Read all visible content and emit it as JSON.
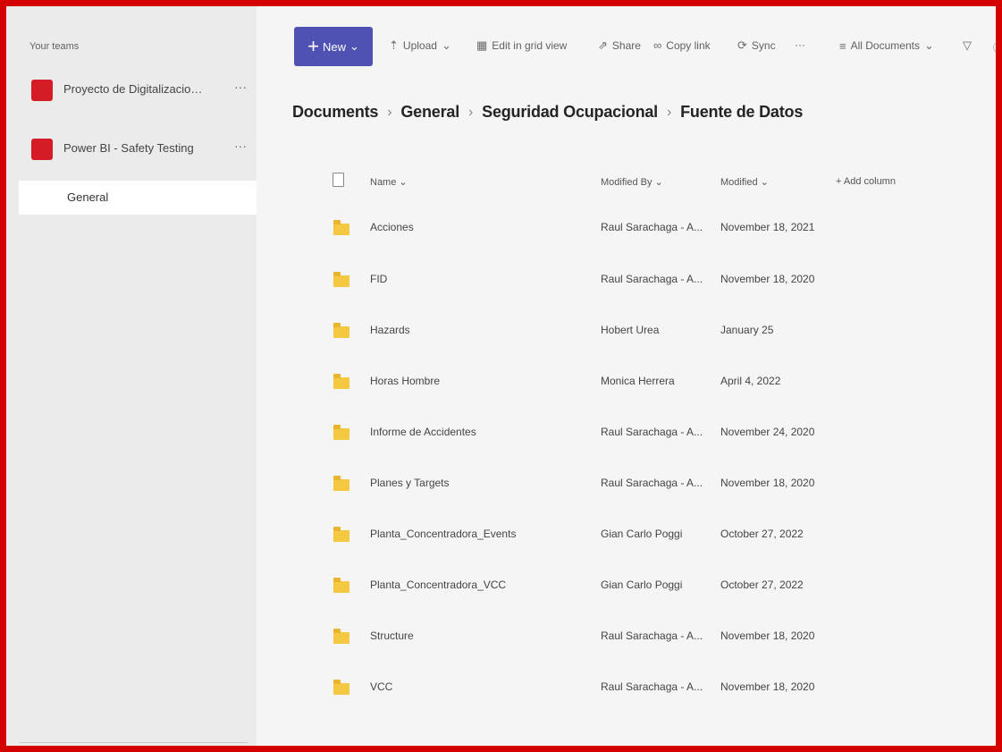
{
  "sidebar": {
    "title": "Your teams",
    "teams": [
      {
        "badge": "",
        "label": "Proyecto de Digitalizacion de S...",
        "more": "···"
      },
      {
        "badge": "",
        "label": "Power BI - Safety Testing",
        "more": "···"
      }
    ],
    "channel": "General"
  },
  "toolbar": {
    "new_label": "New",
    "upload": "Upload",
    "edit_grid": "Edit in grid view",
    "share": "Share",
    "copy_link": "Copy link",
    "sync": "Sync",
    "more": "···",
    "view": "All Documents",
    "filter_icon": "filter-icon",
    "info_icon": "info-icon"
  },
  "breadcrumb": {
    "items": [
      "Documents",
      "General",
      "Seguridad Ocupacional"
    ],
    "current": "Fuente de Datos"
  },
  "columns": {
    "name": "Name",
    "modified_by": "Modified By",
    "modified": "Modified",
    "add_column": "+ Add column"
  },
  "rows": [
    {
      "name": "Acciones",
      "modified_by": "Raul Sarachaga - A...",
      "modified": "November 18, 2021"
    },
    {
      "name": "FID",
      "modified_by": "Raul Sarachaga - A...",
      "modified": "November 18, 2020"
    },
    {
      "name": "Hazards",
      "modified_by": "Hobert Urea",
      "modified": "January 25"
    },
    {
      "name": "Horas Hombre",
      "modified_by": "Monica Herrera",
      "modified": "April 4, 2022"
    },
    {
      "name": "Informe de Accidentes",
      "modified_by": "Raul Sarachaga - A...",
      "modified": "November 24, 2020"
    },
    {
      "name": "Planes y Targets",
      "modified_by": "Raul Sarachaga - A...",
      "modified": "November 18, 2020"
    },
    {
      "name": "Planta_Concentradora_Events",
      "modified_by": "Gian Carlo Poggi",
      "modified": "October 27, 2022"
    },
    {
      "name": "Planta_Concentradora_VCC",
      "modified_by": "Gian Carlo Poggi",
      "modified": "October 27, 2022"
    },
    {
      "name": "Structure",
      "modified_by": "Raul Sarachaga - A...",
      "modified": "November 18, 2020"
    },
    {
      "name": "VCC",
      "modified_by": "Raul Sarachaga - A...",
      "modified": "November 18, 2020"
    }
  ],
  "colors": {
    "frame": "#d40000",
    "accent": "#4f52b2",
    "team_badge": "#d41c27",
    "folder": "#f5c842"
  }
}
